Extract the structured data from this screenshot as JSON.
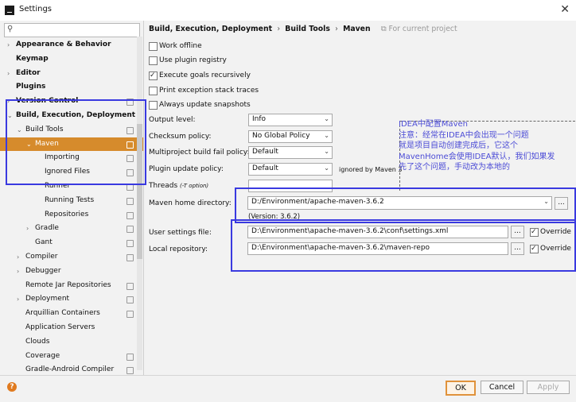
{
  "window": {
    "title": "Settings"
  },
  "sidebar": {
    "search_placeholder": "",
    "items": [
      {
        "label": "Appearance & Behavior",
        "indent": 0,
        "arrow": "›",
        "bold": true
      },
      {
        "label": "Keymap",
        "indent": 0,
        "arrow": "",
        "bold": true
      },
      {
        "label": "Editor",
        "indent": 0,
        "arrow": "›",
        "bold": true
      },
      {
        "label": "Plugins",
        "indent": 0,
        "arrow": "",
        "bold": true
      },
      {
        "label": "Version Control",
        "indent": 0,
        "arrow": "›",
        "bold": true,
        "icon": true
      },
      {
        "label": "Build, Execution, Deployment",
        "indent": 0,
        "arrow": "⌄",
        "bold": true
      },
      {
        "label": "Build Tools",
        "indent": 1,
        "arrow": "⌄",
        "bold": false,
        "icon": true
      },
      {
        "label": "Maven",
        "indent": 2,
        "arrow": "⌄",
        "bold": false,
        "icon": true,
        "selected": true
      },
      {
        "label": "Importing",
        "indent": 3,
        "arrow": "",
        "bold": false,
        "icon": true
      },
      {
        "label": "Ignored Files",
        "indent": 3,
        "arrow": "",
        "bold": false,
        "icon": true
      },
      {
        "label": "Runner",
        "indent": 3,
        "arrow": "",
        "bold": false,
        "icon": true
      },
      {
        "label": "Running Tests",
        "indent": 3,
        "arrow": "",
        "bold": false,
        "icon": true
      },
      {
        "label": "Repositories",
        "indent": 3,
        "arrow": "",
        "bold": false,
        "icon": true
      },
      {
        "label": "Gradle",
        "indent": 2,
        "arrow": "›",
        "bold": false,
        "icon": true
      },
      {
        "label": "Gant",
        "indent": 2,
        "arrow": "",
        "bold": false,
        "icon": true
      },
      {
        "label": "Compiler",
        "indent": 1,
        "arrow": "›",
        "bold": false,
        "icon": true
      },
      {
        "label": "Debugger",
        "indent": 1,
        "arrow": "›",
        "bold": false,
        "icon": false
      },
      {
        "label": "Remote Jar Repositories",
        "indent": 1,
        "arrow": "",
        "bold": false,
        "icon": true
      },
      {
        "label": "Deployment",
        "indent": 1,
        "arrow": "›",
        "bold": false,
        "icon": true
      },
      {
        "label": "Arquillian Containers",
        "indent": 1,
        "arrow": "",
        "bold": false,
        "icon": true
      },
      {
        "label": "Application Servers",
        "indent": 1,
        "arrow": "",
        "bold": false,
        "icon": false
      },
      {
        "label": "Clouds",
        "indent": 1,
        "arrow": "",
        "bold": false,
        "icon": false
      },
      {
        "label": "Coverage",
        "indent": 1,
        "arrow": "",
        "bold": false,
        "icon": true
      },
      {
        "label": "Gradle-Android Compiler",
        "indent": 1,
        "arrow": "",
        "bold": false,
        "icon": true
      }
    ]
  },
  "breadcrumb": {
    "part1": "Build, Execution, Deployment",
    "part2": "Build Tools",
    "part3": "Maven",
    "sep": "›",
    "hint": "For current project"
  },
  "options": {
    "work_offline": {
      "label": "Work offline",
      "checked": false
    },
    "use_plugin_registry": {
      "label": "Use plugin registry",
      "checked": false
    },
    "execute_goals_recursively": {
      "label": "Execute goals recursively",
      "checked": true
    },
    "print_exception_stack_traces": {
      "label": "Print exception stack traces",
      "checked": false
    },
    "always_update_snapshots": {
      "label": "Always update snapshots",
      "checked": false
    }
  },
  "form": {
    "output_level_label": "Output level:",
    "output_level_value": "Info",
    "checksum_policy_label": "Checksum policy:",
    "checksum_policy_value": "No Global Policy",
    "multiproject_label": "Multiproject build fail policy:",
    "multiproject_value": "Default",
    "plugin_update_label": "Plugin update policy:",
    "plugin_update_value": "Default",
    "plugin_update_note": "ignored by Maven 3",
    "threads_label": "Threads",
    "threads_hint": "(-T option)",
    "threads_value": "",
    "maven_home_label": "Maven home directory:",
    "maven_home_value": "D:/Environment/apache-maven-3.6.2",
    "maven_version": "(Version: 3.6.2)",
    "user_settings_label": "User settings file:",
    "user_settings_value": "D:\\Environment\\apache-maven-3.6.2\\conf\\settings.xml",
    "local_repo_label": "Local repository:",
    "local_repo_value": "D:\\Environment\\apache-maven-3.6.2\\maven-repo",
    "browse_label": "...",
    "override_label": "Override"
  },
  "annotation": {
    "line1": "IDEA中配置Maven",
    "line2": "注意：经常在IDEA中会出现一个问题",
    "line3": "就是项目自动创建完成后，它这个",
    "line4": "MavenHome会使用IDEA默认，我们如果发",
    "line5": "先了这个问题，手动改为本地的"
  },
  "footer": {
    "ok_label": "OK",
    "cancel_label": "Cancel",
    "apply_label": "Apply",
    "help_label": "?"
  },
  "colors": {
    "selection": "#d68b2c",
    "annotation_text": "#4c4cd6",
    "highlight_box": "#3a3ae0"
  }
}
